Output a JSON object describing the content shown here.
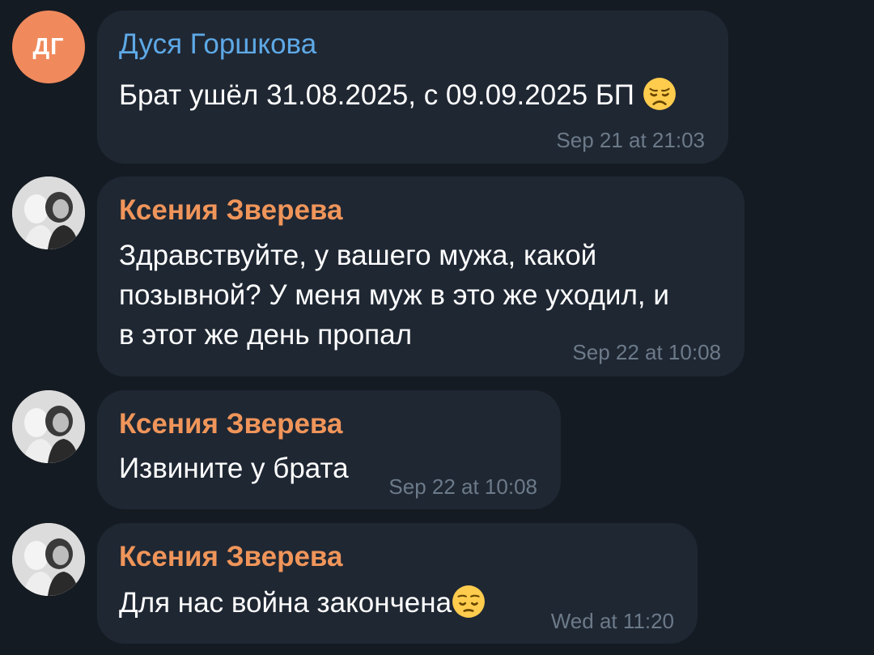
{
  "messages": [
    {
      "avatar_initials": "ДГ",
      "sender": "Дуся Горшкова",
      "text_line1": "Брат ушёл 31.08.2025, с 09.09.2025 БП",
      "emoji": "disappointed-face-icon",
      "time": "Sep 21 at 21:03"
    },
    {
      "sender": "Ксения Зверева",
      "text_line1": "Здравствуйте, у вашего мужа, какой",
      "text_line2": "позывной? У меня муж в это же уходил, и",
      "text_line3": "в этот же день пропал",
      "time": "Sep 22 at 10:08"
    },
    {
      "sender": "Ксения Зверева",
      "text_line1": "Извините у брата",
      "time": "Sep 22 at 10:08"
    },
    {
      "sender": "Ксения Зверева",
      "text_line1": "Для нас война закончена",
      "emoji": "pensive-face-icon",
      "time": "Wed at 11:20"
    }
  ],
  "colors": {
    "background": "#151b22",
    "bubble": "#1f2733",
    "sender_blue": "#5ea9e6",
    "sender_orange": "#f0955a",
    "avatar_orange": "#f08a5d",
    "timestamp": "#6c7a89"
  }
}
